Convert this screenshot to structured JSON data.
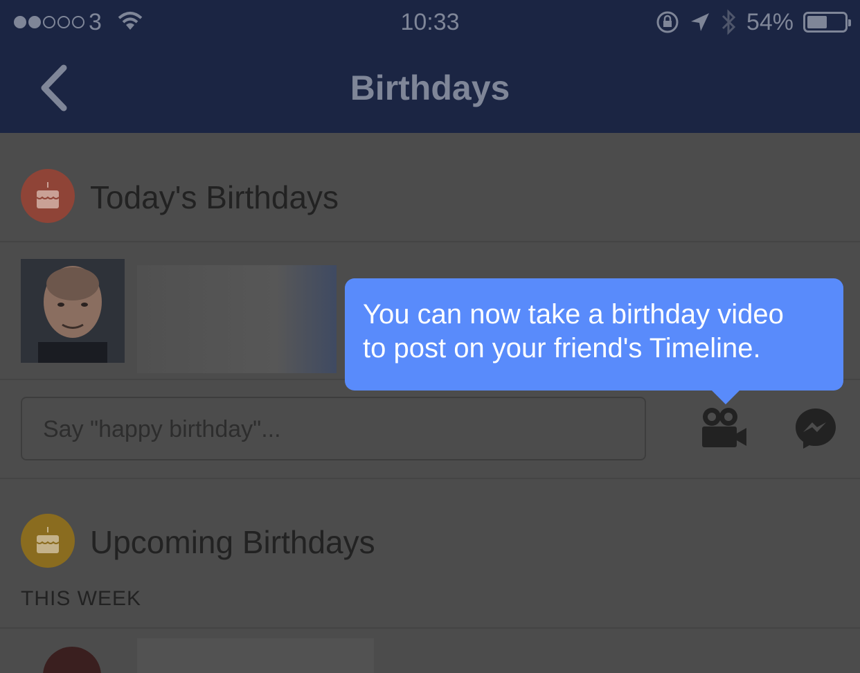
{
  "status_bar": {
    "carrier": "3",
    "time": "10:33",
    "battery": "54%",
    "battery_level": 0.54,
    "signal_bars": 2
  },
  "nav": {
    "title": "Birthdays"
  },
  "sections": {
    "today_title": "Today's Birthdays",
    "upcoming_title": "Upcoming Birthdays",
    "this_week": "THIS WEEK"
  },
  "composer": {
    "placeholder": "Say \"happy birthday\"..."
  },
  "tooltip": {
    "line1": "You can now take a birthday video",
    "line2": "to post on your friend's Timeline."
  },
  "colors": {
    "nav_bg": "#1b2543",
    "tooltip_bg": "#598bfb",
    "today_icon": "#8f4437",
    "upcoming_icon": "#8a6c1f"
  },
  "icons": {
    "back": "chevron-left-icon",
    "today": "birthday-cake-icon",
    "upcoming": "birthday-cake-icon",
    "video": "video-camera-icon",
    "messenger": "messenger-icon"
  }
}
